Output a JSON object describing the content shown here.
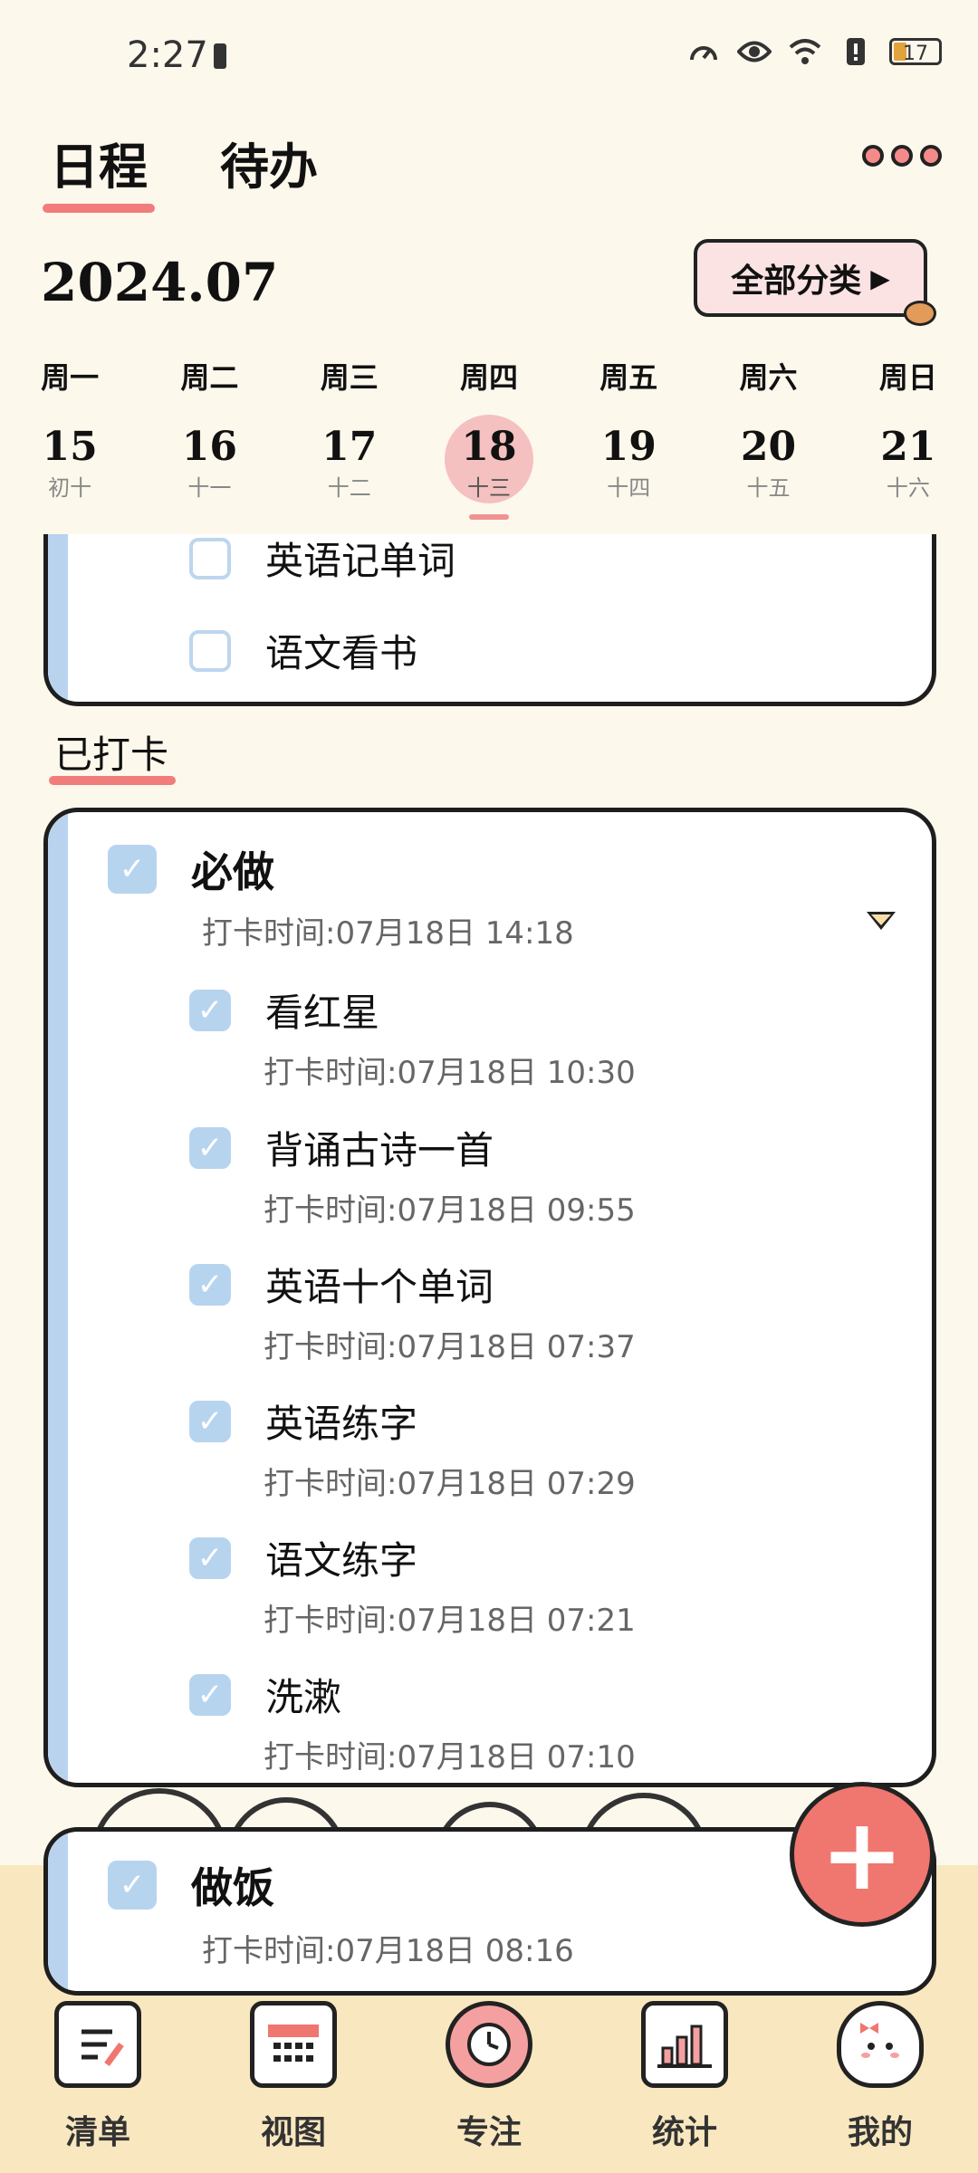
{
  "status_bar": {
    "time": "2:27",
    "battery": "17"
  },
  "header": {
    "tabs": [
      {
        "label": "日程"
      },
      {
        "label": "待办"
      }
    ]
  },
  "calendar": {
    "month": "2024.07",
    "category_button": "全部分类",
    "days": [
      {
        "weekday": "周一",
        "date": "15",
        "lunar": "初十"
      },
      {
        "weekday": "周二",
        "date": "16",
        "lunar": "十一"
      },
      {
        "weekday": "周三",
        "date": "17",
        "lunar": "十二"
      },
      {
        "weekday": "周四",
        "date": "18",
        "lunar": "十三",
        "selected": true
      },
      {
        "weekday": "周五",
        "date": "19",
        "lunar": "十四"
      },
      {
        "weekday": "周六",
        "date": "20",
        "lunar": "十五"
      },
      {
        "weekday": "周日",
        "date": "21",
        "lunar": "十六"
      }
    ]
  },
  "pending_tasks": [
    {
      "name": "英语记单词",
      "done": false
    },
    {
      "name": "语文看书",
      "done": false
    }
  ],
  "done_section": {
    "label": "已打卡"
  },
  "group_required": {
    "name": "必做",
    "time": "打卡时间:07月18日 14:18",
    "tasks": [
      {
        "name": "看红星",
        "time": "打卡时间:07月18日 10:30"
      },
      {
        "name": "背诵古诗一首",
        "time": "打卡时间:07月18日 09:55"
      },
      {
        "name": "英语十个单词",
        "time": "打卡时间:07月18日 07:37"
      },
      {
        "name": "英语练字",
        "time": "打卡时间:07月18日 07:29"
      },
      {
        "name": "语文练字",
        "time": "打卡时间:07月18日 07:21"
      },
      {
        "name": "洗漱",
        "time": "打卡时间:07月18日 07:10"
      }
    ]
  },
  "group_cook": {
    "name": "做饭",
    "time": "打卡时间:07月18日 08:16"
  },
  "bottom_nav": [
    {
      "label": "清单",
      "icon": "checklist-icon"
    },
    {
      "label": "视图",
      "icon": "calendar-icon"
    },
    {
      "label": "专注",
      "icon": "alarm-clock-icon"
    },
    {
      "label": "统计",
      "icon": "bar-chart-icon"
    },
    {
      "label": "我的",
      "icon": "bunny-avatar-icon"
    }
  ],
  "colors": {
    "accent": "#f17c7c",
    "check": "#b7d4ef",
    "background": "#fdf8ec"
  }
}
